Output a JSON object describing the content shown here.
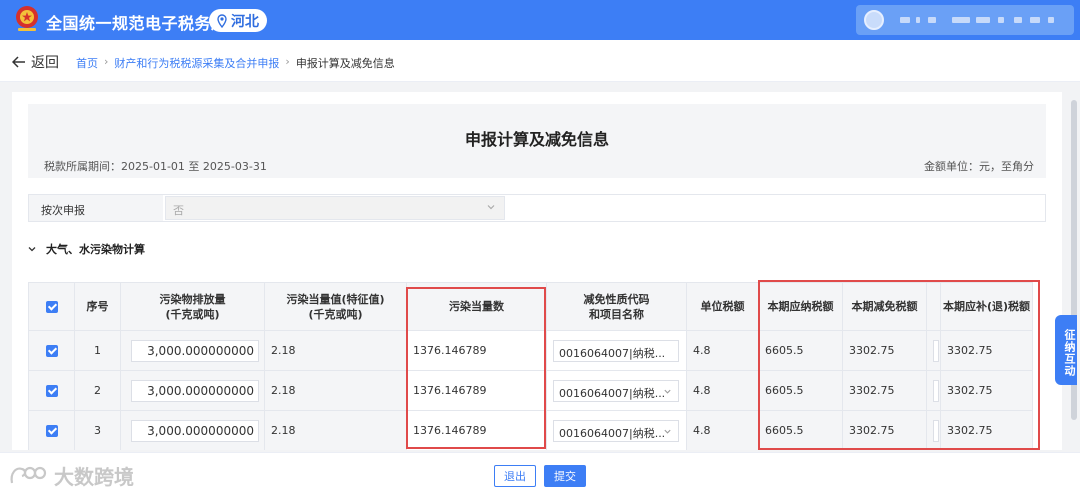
{
  "header": {
    "brand": "全国统一规范电子税务局",
    "region": "河北"
  },
  "nav": {
    "back": "返回",
    "breadcrumb": [
      "首页",
      "财产和行为税税源采集及合并申报",
      "申报计算及减免信息"
    ]
  },
  "form": {
    "title": "申报计算及减免信息",
    "period": "税款所属期间：2025-01-01 至 2025-03-31",
    "unit": "金额单位：元，至角分",
    "declare_label": "按次申报",
    "declare_value": "否",
    "section": "大气、水污染物计算"
  },
  "table": {
    "headers": {
      "seq": "序号",
      "emission": [
        "污染物排放量",
        "(千克或吨)"
      ],
      "equiv_value": [
        "污染当量值(特征值)",
        "(千克或吨)"
      ],
      "equiv_count": "污染当量数",
      "relief_code": [
        "减免性质代码",
        "和项目名称"
      ],
      "unit_tax": "单位税额",
      "tax_payable": "本期应纳税额",
      "tax_relief": "本期减免税额",
      "tax_due": "本期应补(退)税额"
    },
    "rows": [
      {
        "seq": "1",
        "emission": "3,000.000000000",
        "equiv_value": "2.18",
        "equiv_count": "1376.146789",
        "relief_code": "0016064007|纳税...",
        "unit_tax": "4.8",
        "tax_payable": "6605.5",
        "tax_relief": "3302.75",
        "tax_due": "3302.75"
      },
      {
        "seq": "2",
        "emission": "3,000.000000000",
        "equiv_value": "2.18",
        "equiv_count": "1376.146789",
        "relief_code": "0016064007|纳税...",
        "unit_tax": "4.8",
        "tax_payable": "6605.5",
        "tax_relief": "3302.75",
        "tax_due": "3302.75"
      },
      {
        "seq": "3",
        "emission": "3,000.000000000",
        "equiv_value": "2.18",
        "equiv_count": "1376.146789",
        "relief_code": "0016064007|纳税...",
        "unit_tax": "4.8",
        "tax_payable": "6605.5",
        "tax_relief": "3302.75",
        "tax_due": "3302.75"
      }
    ]
  },
  "side": {
    "interaction": "征纳互动"
  },
  "footer": {
    "exit": "退出",
    "submit": "提交",
    "watermark": "大数跨境"
  },
  "colors": {
    "accent": "#3d7ef5",
    "highlight": "#e04a4a"
  }
}
